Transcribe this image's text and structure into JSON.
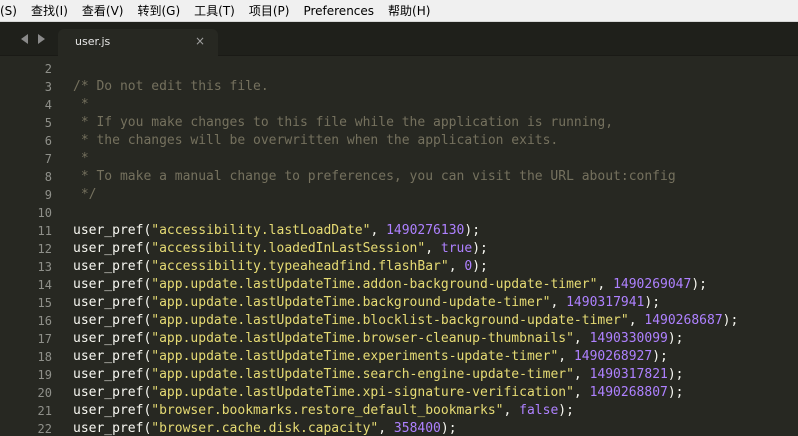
{
  "menu": {
    "items": [
      {
        "label": "(S)"
      },
      {
        "label": "查找(I)"
      },
      {
        "label": "查看(V)"
      },
      {
        "label": "转到(G)"
      },
      {
        "label": "工具(T)"
      },
      {
        "label": "项目(P)"
      },
      {
        "label": "Preferences"
      },
      {
        "label": "帮助(H)"
      }
    ]
  },
  "tabs": {
    "prev_icon": "arrow-left-icon",
    "next_icon": "arrow-right-icon",
    "active": {
      "label": "user.js",
      "close_glyph": "×"
    }
  },
  "colors": {
    "background": "#272822",
    "comment": "#75715e",
    "string": "#e6db74",
    "number": "#ae81ff",
    "text": "#f8f8f2",
    "gutter": "#8f908a"
  },
  "editor": {
    "lines": [
      {
        "num": "2",
        "tokens": []
      },
      {
        "num": "3",
        "tokens": [
          {
            "t": "c",
            "v": "/* Do not edit this file."
          }
        ]
      },
      {
        "num": "4",
        "tokens": [
          {
            "t": "c",
            "v": " *"
          }
        ]
      },
      {
        "num": "5",
        "tokens": [
          {
            "t": "c",
            "v": " * If you make changes to this file while the application is running,"
          }
        ]
      },
      {
        "num": "6",
        "tokens": [
          {
            "t": "c",
            "v": " * the changes will be overwritten when the application exits."
          }
        ]
      },
      {
        "num": "7",
        "tokens": [
          {
            "t": "c",
            "v": " *"
          }
        ]
      },
      {
        "num": "8",
        "tokens": [
          {
            "t": "c",
            "v": " * To make a manual change to preferences, you can visit the URL about:config"
          }
        ]
      },
      {
        "num": "9",
        "tokens": [
          {
            "t": "c",
            "v": " */"
          }
        ]
      },
      {
        "num": "10",
        "tokens": []
      },
      {
        "num": "11",
        "tokens": [
          {
            "t": "f",
            "v": "user_pref("
          },
          {
            "t": "s",
            "v": "\"accessibility.lastLoadDate\""
          },
          {
            "t": "p",
            "v": ", "
          },
          {
            "t": "n",
            "v": "1490276130"
          },
          {
            "t": "p",
            "v": ");"
          }
        ]
      },
      {
        "num": "12",
        "tokens": [
          {
            "t": "f",
            "v": "user_pref("
          },
          {
            "t": "s",
            "v": "\"accessibility.loadedInLastSession\""
          },
          {
            "t": "p",
            "v": ", "
          },
          {
            "t": "n",
            "v": "true"
          },
          {
            "t": "p",
            "v": ");"
          }
        ]
      },
      {
        "num": "13",
        "tokens": [
          {
            "t": "f",
            "v": "user_pref("
          },
          {
            "t": "s",
            "v": "\"accessibility.typeaheadfind.flashBar\""
          },
          {
            "t": "p",
            "v": ", "
          },
          {
            "t": "n",
            "v": "0"
          },
          {
            "t": "p",
            "v": ");"
          }
        ]
      },
      {
        "num": "14",
        "tokens": [
          {
            "t": "f",
            "v": "user_pref("
          },
          {
            "t": "s",
            "v": "\"app.update.lastUpdateTime.addon-background-update-timer\""
          },
          {
            "t": "p",
            "v": ", "
          },
          {
            "t": "n",
            "v": "1490269047"
          },
          {
            "t": "p",
            "v": ");"
          }
        ]
      },
      {
        "num": "15",
        "tokens": [
          {
            "t": "f",
            "v": "user_pref("
          },
          {
            "t": "s",
            "v": "\"app.update.lastUpdateTime.background-update-timer\""
          },
          {
            "t": "p",
            "v": ", "
          },
          {
            "t": "n",
            "v": "1490317941"
          },
          {
            "t": "p",
            "v": ");"
          }
        ]
      },
      {
        "num": "16",
        "tokens": [
          {
            "t": "f",
            "v": "user_pref("
          },
          {
            "t": "s",
            "v": "\"app.update.lastUpdateTime.blocklist-background-update-timer\""
          },
          {
            "t": "p",
            "v": ", "
          },
          {
            "t": "n",
            "v": "1490268687"
          },
          {
            "t": "p",
            "v": ");"
          }
        ]
      },
      {
        "num": "17",
        "tokens": [
          {
            "t": "f",
            "v": "user_pref("
          },
          {
            "t": "s",
            "v": "\"app.update.lastUpdateTime.browser-cleanup-thumbnails\""
          },
          {
            "t": "p",
            "v": ", "
          },
          {
            "t": "n",
            "v": "1490330099"
          },
          {
            "t": "p",
            "v": ");"
          }
        ]
      },
      {
        "num": "18",
        "tokens": [
          {
            "t": "f",
            "v": "user_pref("
          },
          {
            "t": "s",
            "v": "\"app.update.lastUpdateTime.experiments-update-timer\""
          },
          {
            "t": "p",
            "v": ", "
          },
          {
            "t": "n",
            "v": "1490268927"
          },
          {
            "t": "p",
            "v": ");"
          }
        ]
      },
      {
        "num": "19",
        "tokens": [
          {
            "t": "f",
            "v": "user_pref("
          },
          {
            "t": "s",
            "v": "\"app.update.lastUpdateTime.search-engine-update-timer\""
          },
          {
            "t": "p",
            "v": ", "
          },
          {
            "t": "n",
            "v": "1490317821"
          },
          {
            "t": "p",
            "v": ");"
          }
        ]
      },
      {
        "num": "20",
        "tokens": [
          {
            "t": "f",
            "v": "user_pref("
          },
          {
            "t": "s",
            "v": "\"app.update.lastUpdateTime.xpi-signature-verification\""
          },
          {
            "t": "p",
            "v": ", "
          },
          {
            "t": "n",
            "v": "1490268807"
          },
          {
            "t": "p",
            "v": ");"
          }
        ]
      },
      {
        "num": "21",
        "tokens": [
          {
            "t": "f",
            "v": "user_pref("
          },
          {
            "t": "s",
            "v": "\"browser.bookmarks.restore_default_bookmarks\""
          },
          {
            "t": "p",
            "v": ", "
          },
          {
            "t": "n",
            "v": "false"
          },
          {
            "t": "p",
            "v": ");"
          }
        ]
      },
      {
        "num": "22",
        "tokens": [
          {
            "t": "f",
            "v": "user_pref("
          },
          {
            "t": "s",
            "v": "\"browser.cache.disk.capacity\""
          },
          {
            "t": "p",
            "v": ", "
          },
          {
            "t": "n",
            "v": "358400"
          },
          {
            "t": "p",
            "v": ");"
          }
        ]
      }
    ]
  }
}
